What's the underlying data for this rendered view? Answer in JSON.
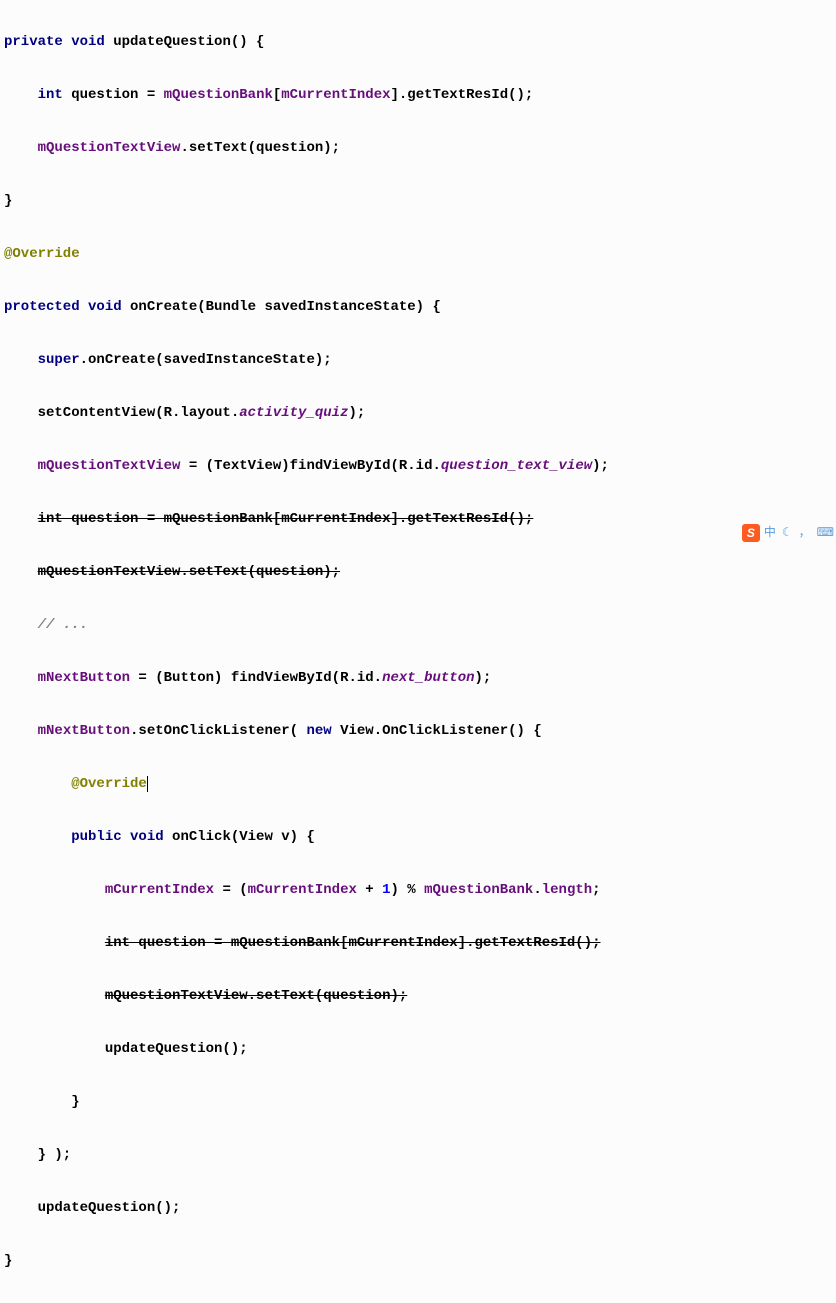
{
  "lines": {
    "l1": {
      "t1": "private void",
      "t2": " updateQuestion() {"
    },
    "l2": {
      "t1": "    ",
      "t2": "int",
      "t3": " question = ",
      "t4": "mQuestionBank",
      "t5": "[",
      "t6": "mCurrentIndex",
      "t7": "].getTextResId();"
    },
    "l3": {
      "t1": "    ",
      "t2": "mQuestionTextView",
      "t3": ".setText(question);"
    },
    "l4": {
      "t1": "}"
    },
    "l5": {
      "t1": "@Override"
    },
    "l6": {
      "t1": "protected void",
      "t2": " onCreate(Bundle savedInstanceState) {"
    },
    "l7": {
      "t1": "    ",
      "t2": "super",
      "t3": ".onCreate(savedInstanceState);"
    },
    "l8": {
      "t1": "    setContentView(R.layout.",
      "t2": "activity_quiz",
      "t3": ");"
    },
    "l9": {
      "t1": "    ",
      "t2": "mQuestionTextView",
      "t3": " = (TextView)findViewById(R.id.",
      "t4": "question_text_view",
      "t5": ");"
    },
    "l10": {
      "t1": "    ",
      "t2": "int question = mQuestionBank[mCurrentIndex].getTextResId();"
    },
    "l11": {
      "t1": "    ",
      "t2": "mQuestionTextView.setText(question);"
    },
    "l12": {
      "t1": "    ",
      "t2": "// ..."
    },
    "l13": {
      "t1": "    ",
      "t2": "mNextButton",
      "t3": " = (Button) findViewById(R.id.",
      "t4": "next_button",
      "t5": ");"
    },
    "l14": {
      "t1": "    ",
      "t2": "mNextButton",
      "t3": ".setOnClickListener( ",
      "t4": "new",
      "t5": " View.OnClickListener() {"
    },
    "l15": {
      "t1": "        ",
      "t2": "@Override"
    },
    "l16": {
      "t1": "        ",
      "t2": "public void",
      "t3": " onClick(View v) {"
    },
    "l17": {
      "t1": "            ",
      "t2": "mCurrentIndex",
      "t3": " = (",
      "t4": "mCurrentIndex",
      "t5": " + ",
      "t6": "1",
      "t7": ") % ",
      "t8": "mQuestionBank",
      "t9": ".",
      "t10": "length",
      "t11": ";"
    },
    "l18": {
      "t1": "            ",
      "t2": "int question = mQuestionBank[mCurrentIndex].getTextResId();"
    },
    "l19": {
      "t1": "            ",
      "t2": "mQuestionTextView.setText(question);"
    },
    "l20": {
      "t1": "            updateQuestion();"
    },
    "l21": {
      "t1": "        }"
    },
    "l22": {
      "t1": "    } );"
    },
    "l23": {
      "t1": "    updateQuestion();"
    },
    "l24": {
      "t1": "}"
    }
  },
  "toolbar": {
    "badge": "S",
    "lang": "中",
    "comma": "，"
  }
}
